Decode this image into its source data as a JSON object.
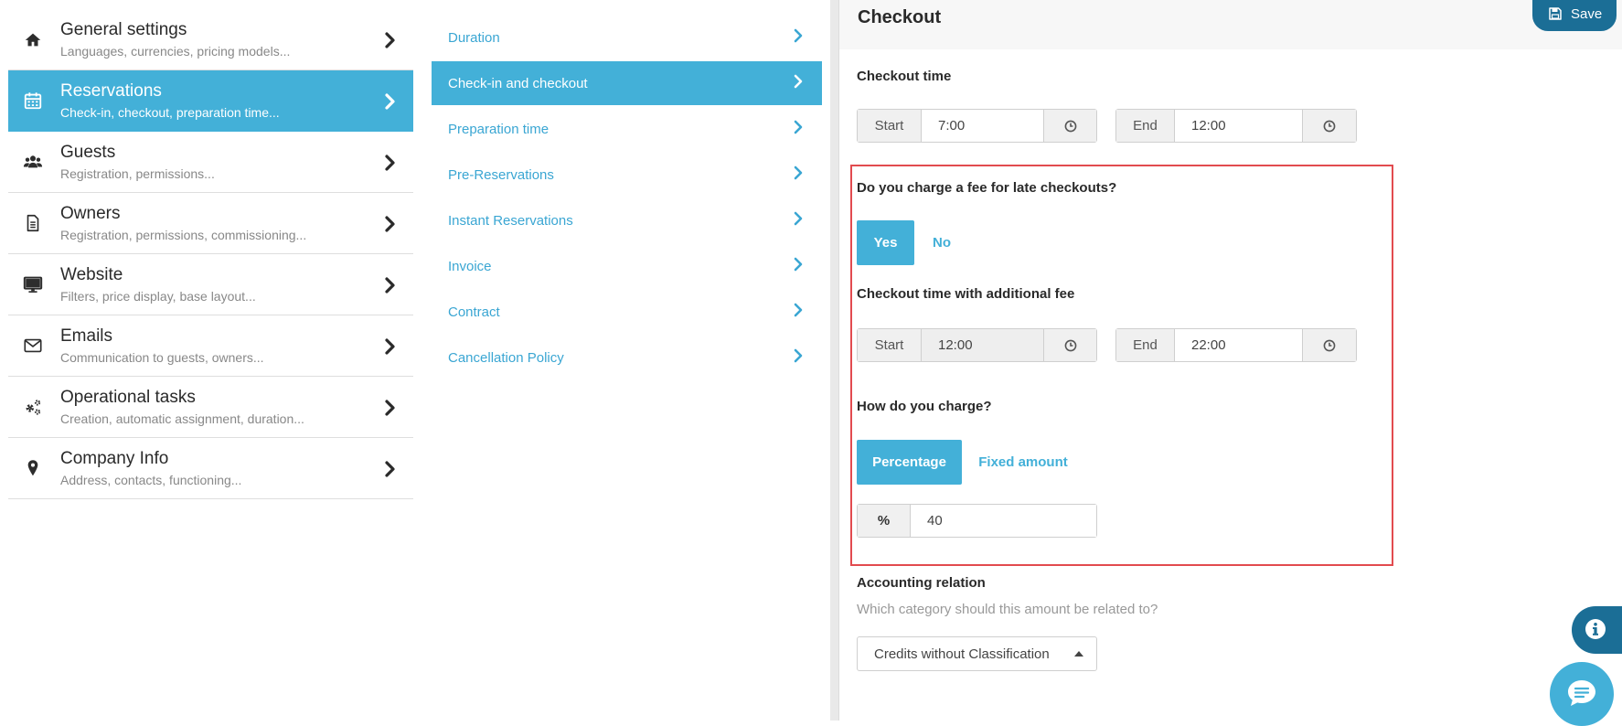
{
  "left_nav": [
    {
      "title": "General settings",
      "subtitle": "Languages, currencies, pricing models...",
      "icon": "home-icon"
    },
    {
      "title": "Reservations",
      "subtitle": "Check-in, checkout, preparation time...",
      "icon": "calendar-icon"
    },
    {
      "title": "Guests",
      "subtitle": "Registration, permissions...",
      "icon": "users-icon"
    },
    {
      "title": "Owners",
      "subtitle": "Registration, permissions, commissioning...",
      "icon": "document-icon"
    },
    {
      "title": "Website",
      "subtitle": "Filters, price display, base layout...",
      "icon": "monitor-icon"
    },
    {
      "title": "Emails",
      "subtitle": "Communication to guests, owners...",
      "icon": "envelope-icon"
    },
    {
      "title": "Operational tasks",
      "subtitle": "Creation, automatic assignment, duration...",
      "icon": "gears-icon"
    },
    {
      "title": "Company Info",
      "subtitle": "Address, contacts, functioning...",
      "icon": "map-pin-icon"
    }
  ],
  "left_nav_active": "Reservations",
  "sub_nav": [
    "Duration",
    "Check-in and checkout",
    "Preparation time",
    "Pre-Reservations",
    "Instant Reservations",
    "Invoice",
    "Contract",
    "Cancellation Policy"
  ],
  "sub_nav_active": "Check-in and checkout",
  "panel": {
    "title": "Checkout",
    "save_label": "Save",
    "checkout_time": {
      "label": "Checkout time",
      "start_label": "Start",
      "start_value": "7:00",
      "end_label": "End",
      "end_value": "12:00"
    },
    "late_fee": {
      "question": "Do you charge a fee for late checkouts?",
      "yes_label": "Yes",
      "no_label": "No",
      "selected": "Yes"
    },
    "additional_fee_time": {
      "label": "Checkout time with additional fee",
      "start_label": "Start",
      "start_value": "12:00",
      "end_label": "End",
      "end_value": "22:00"
    },
    "charge_method": {
      "question": "How do you charge?",
      "percentage_label": "Percentage",
      "fixed_label": "Fixed amount",
      "selected": "Percentage",
      "percent_symbol": "%",
      "percent_value": "40"
    },
    "accounting": {
      "label": "Accounting relation",
      "hint": "Which category should this amount be related to?",
      "selected": "Credits without Classification"
    }
  },
  "colors": {
    "accent": "#43b0d8",
    "dark_accent": "#1b6e96",
    "highlight_border": "#e24b4f"
  }
}
